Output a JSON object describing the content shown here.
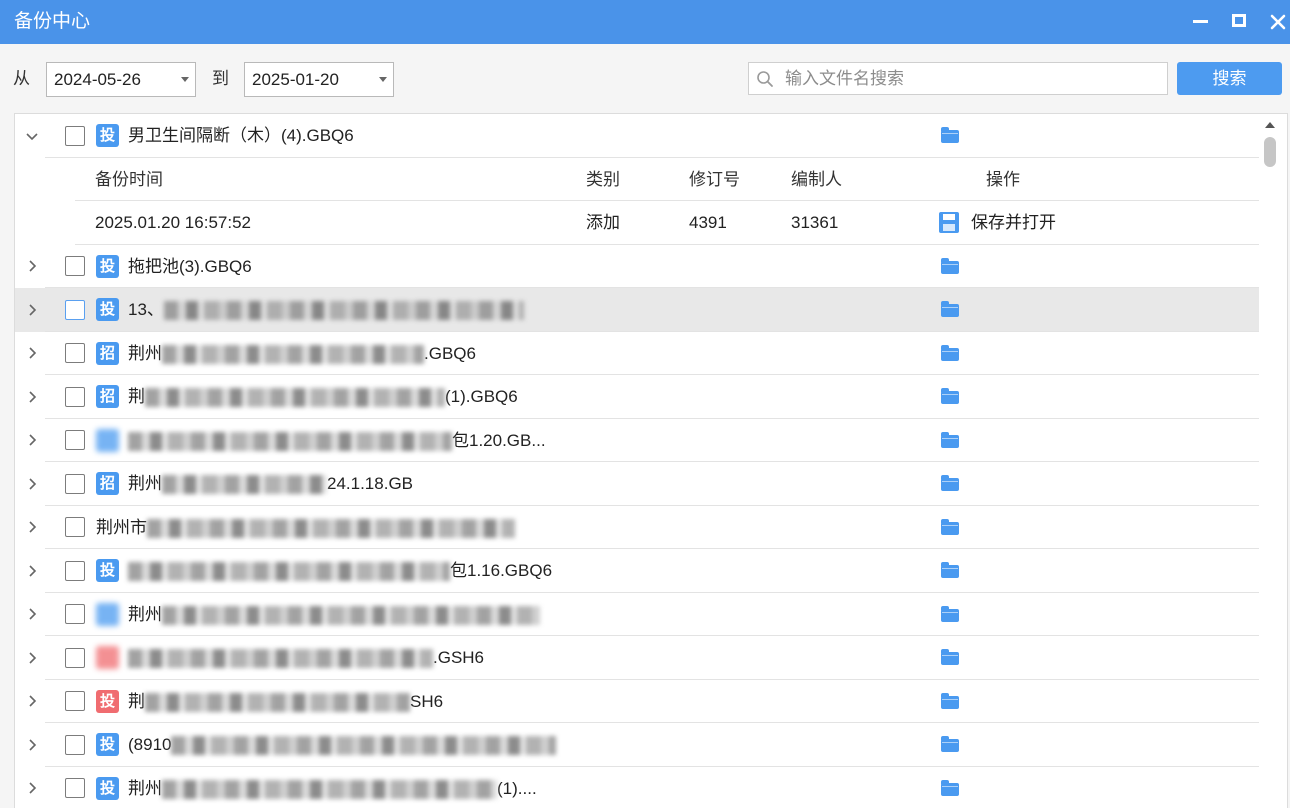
{
  "window": {
    "title": "备份中心",
    "controls": [
      "minimize-icon",
      "maximize-icon",
      "close-icon"
    ]
  },
  "filter": {
    "from_label": "从",
    "from_date": "2024-05-26",
    "to_label": "到",
    "to_date": "2025-01-20",
    "search_placeholder": "输入文件名搜索",
    "search_value": "",
    "search_button": "搜索"
  },
  "files": [
    {
      "icon_char": "投",
      "name": "男卫生间隔断（木）(4).GBQ6",
      "expanded": true
    },
    {
      "icon_char": "投",
      "name": "拖把池(3).GBQ6",
      "expanded": false
    },
    {
      "icon_char": "投",
      "name_start": "13、",
      "name_end": "",
      "hovered": true
    },
    {
      "icon_char": "招",
      "name_start": "荆州",
      "name_end": ".GBQ6"
    },
    {
      "icon_char": "招",
      "name_start": "荆",
      "name_end": "(1).GBQ6"
    },
    {
      "name_start": "",
      "name_end": "包1.20.GB..."
    },
    {
      "icon_char": "招",
      "name_start": "荆州",
      "name_end": "24.1.18.GB"
    },
    {
      "name_start": "荆州市",
      "name_end": ""
    },
    {
      "icon_char": "投",
      "name_start": "",
      "name_end": "包1.16.GBQ6"
    },
    {
      "name_start": "荆州",
      "name_end": ""
    },
    {
      "name_start": "",
      "name_end": ".GSH6"
    },
    {
      "icon_char": "投",
      "name_start": "荆",
      "name_end": "SH6"
    },
    {
      "icon_char": "投",
      "name_start": "(8910",
      "name_end": ""
    },
    {
      "icon_char": "投",
      "name_start": "荆州",
      "name_end": "(1)...."
    }
  ],
  "backup_table": {
    "columns": [
      "备份时间",
      "类别",
      "修订号",
      "编制人",
      "操作"
    ],
    "rows": [
      {
        "time": "2025.01.20 16:57:52",
        "category": "添加",
        "revision": "4391",
        "author": "31361",
        "action": "保存并打开"
      }
    ]
  },
  "colors": {
    "titlebar": "#4a93e9",
    "accent": "#4d9bf0",
    "file_icon_blue": "#4a9af0",
    "file_icon_red": "#f06c70",
    "hover_row": "#e8e8e8"
  }
}
